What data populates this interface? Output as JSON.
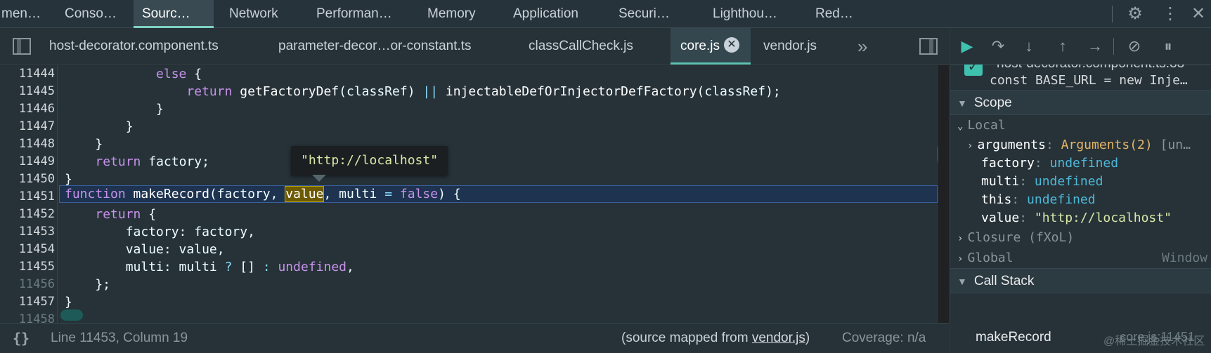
{
  "top_tabs": [
    "men…",
    "Conso…",
    "Sourc…",
    "Network",
    "Performan…",
    "Memory",
    "Application",
    "Securi…",
    "Lighthou…",
    "Red…"
  ],
  "active_top_tab": "Sourc…",
  "file_tabs": [
    "host-decorator.component.ts",
    "parameter-decor…or-constant.ts",
    "classCallCheck.js",
    "core.js",
    "vendor.js"
  ],
  "active_file_tab": "core.js",
  "close_glyph": "✕",
  "more_tabs_glyph": "»",
  "editor": {
    "line_numbers": [
      "11444",
      "11445",
      "11446",
      "11447",
      "11448",
      "11449",
      "11450",
      "11451",
      "11452",
      "11453",
      "11454",
      "11455",
      "11456",
      "11457",
      "11458"
    ],
    "tooltip": "\"http://localhost\""
  },
  "status": {
    "braces": "{}",
    "position": "Line 11453, Column 19",
    "mapped_prefix": "(source mapped from ",
    "mapped_file": "vendor.js",
    "mapped_suffix": ")",
    "coverage": "Coverage: n/a"
  },
  "debugger": {
    "breakpoint_file": "host-decorator.component.ts:33",
    "breakpoint_code": "const BASE_URL = new Inje…",
    "scope_title": "Scope",
    "local_title": "Local",
    "local_vars": [
      {
        "name": "arguments",
        "value": "Arguments(2)",
        "extra": "[un…"
      },
      {
        "name": "factory",
        "value": "undefined"
      },
      {
        "name": "multi",
        "value": "undefined"
      },
      {
        "name": "this",
        "value": "undefined"
      },
      {
        "name": "value",
        "value": "\"http://localhost\""
      }
    ],
    "closure_title": "Closure (fXoL)",
    "global_title": "Global",
    "global_value": "Window",
    "callstack_title": "Call Stack",
    "callstack_fn": "makeRecord",
    "callstack_loc": "core.js:11451"
  },
  "watermark": "@稀土掘金技术社区",
  "colors": {
    "accent": "#5fc3b4",
    "keyword": "#c792ea",
    "undefined": "#4fb8d8",
    "string": "#d9e8a8",
    "highlight_line": "#1e3350"
  }
}
